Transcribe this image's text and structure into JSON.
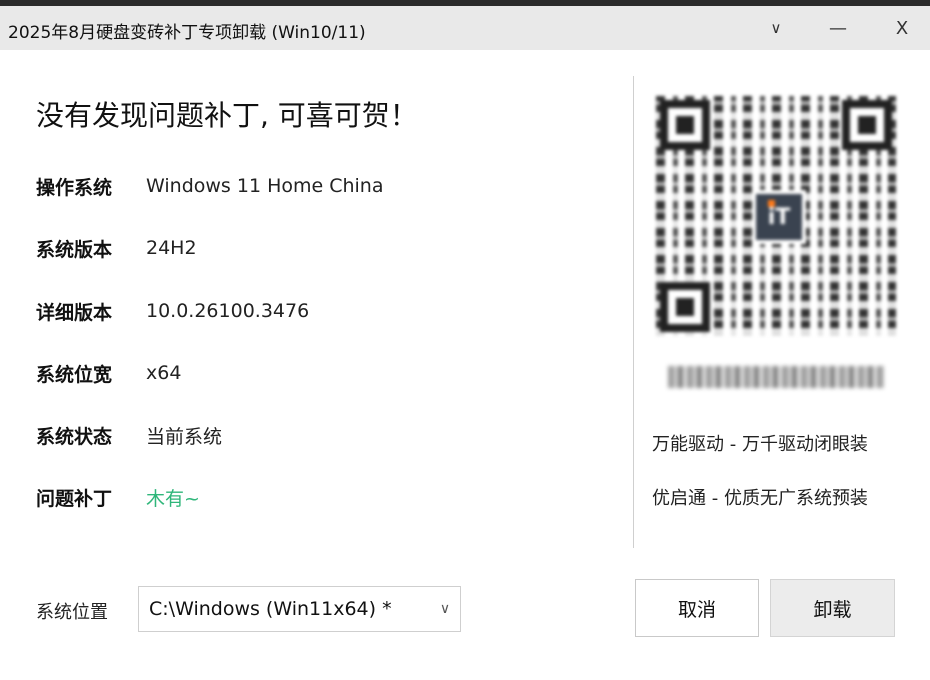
{
  "window": {
    "title": "2025年8月硬盘变砖补丁专项卸载 (Win10/11)",
    "menu_glyph": "∨",
    "minimize_glyph": "—",
    "close_glyph": "X"
  },
  "main": {
    "headline": "没有发现问题补丁, 可喜可贺！",
    "info": [
      {
        "label": "操作系统",
        "value": "Windows 11 Home China"
      },
      {
        "label": "系统版本",
        "value": "24H2"
      },
      {
        "label": "详细版本",
        "value": "10.0.26100.3476"
      },
      {
        "label": "系统位宽",
        "value": "x64"
      },
      {
        "label": "系统状态",
        "value": "当前系统"
      },
      {
        "label": "问题补丁",
        "value": "木有~"
      }
    ],
    "status_color": "#2fb67a"
  },
  "side": {
    "qr_logo_text": "iT",
    "promo_1": "万能驱动 - 万千驱动闭眼装",
    "promo_2": "优启通 - 优质无广系统预装"
  },
  "footer": {
    "location_label": "系统位置",
    "location_value": "C:\\Windows (Win11x64) *",
    "caret": "∨",
    "cancel_label": "取消",
    "uninstall_label": "卸载"
  }
}
